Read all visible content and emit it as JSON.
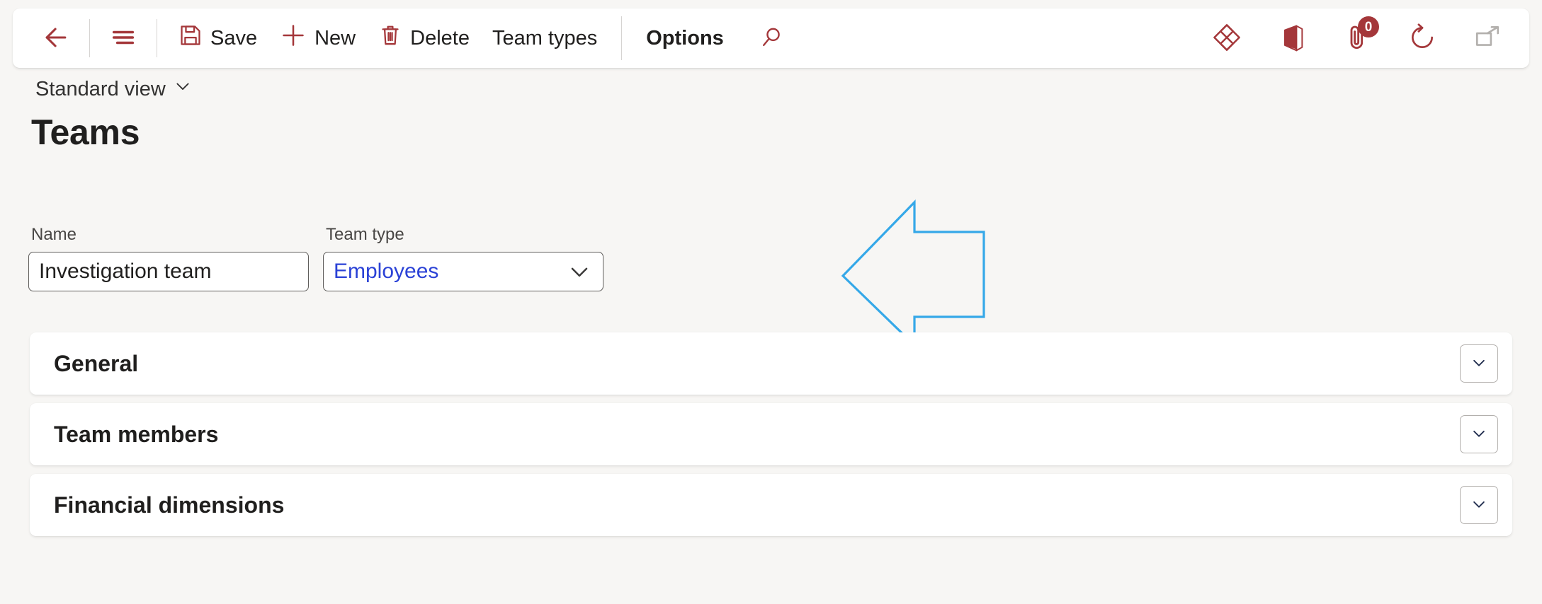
{
  "theme": {
    "accent": "#a4373a",
    "page_background": "#f7f6f4",
    "card_background": "#ffffff",
    "link_blue": "#2b42d6",
    "annotation_blue": "#35a8e8",
    "text_primary": "#201f1e",
    "text_secondary": "#484644"
  },
  "commandbar": {
    "back_label": "Back",
    "showhide_label": "Show/hide navigation pane",
    "items": [
      {
        "id": "save",
        "label": "Save",
        "icon": "save-icon",
        "bold": false
      },
      {
        "id": "new",
        "label": "New",
        "icon": "plus-icon",
        "bold": false
      },
      {
        "id": "delete",
        "label": "Delete",
        "icon": "trash-icon",
        "bold": false
      },
      {
        "id": "team-types",
        "label": "Team types",
        "icon": "",
        "bold": false
      },
      {
        "id": "options",
        "label": "Options",
        "icon": "",
        "bold": true
      }
    ],
    "search_label": "Search",
    "right_icons": [
      {
        "id": "power-apps",
        "name": "power-apps-diamond-icon",
        "color": "#a4373a",
        "badge": null
      },
      {
        "id": "office",
        "name": "office-app-icon",
        "color": "#a4373a",
        "badge": null
      },
      {
        "id": "attachments",
        "name": "attachment-paperclip-icon",
        "color": "#a4373a",
        "badge": "0"
      },
      {
        "id": "refresh",
        "name": "refresh-icon",
        "color": "#a4373a",
        "badge": null
      },
      {
        "id": "popout",
        "name": "open-in-new-window-icon",
        "color": "#b3b0ad",
        "badge": null
      }
    ]
  },
  "page": {
    "view_selector": "Standard view",
    "title": "Teams"
  },
  "form": {
    "fields": [
      {
        "id": "name",
        "label": "Name",
        "value": "Investigation team",
        "placeholder": "",
        "type": "text"
      },
      {
        "id": "team-type",
        "label": "Team type",
        "value": "Employees",
        "placeholder": "",
        "type": "combobox"
      }
    ]
  },
  "annotation": {
    "shape": "left-pointing-arrow",
    "color": "#35a8e8",
    "points_to": "team-type-combobox"
  },
  "sections": [
    {
      "id": "general",
      "title": "General",
      "expanded": false
    },
    {
      "id": "team-members",
      "title": "Team members",
      "expanded": false
    },
    {
      "id": "financial-dimensions",
      "title": "Financial dimensions",
      "expanded": false
    }
  ]
}
